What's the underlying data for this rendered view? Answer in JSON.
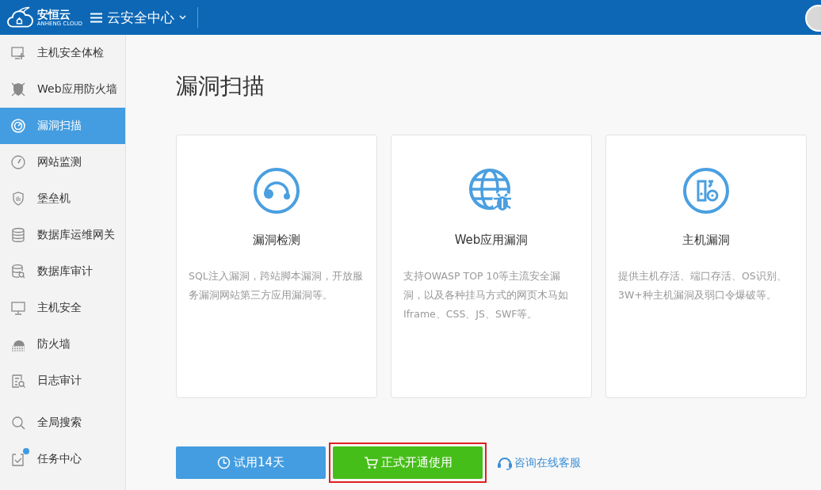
{
  "header": {
    "logo": {
      "name": "安恒云",
      "tagline": "ANHENG CLOUD"
    },
    "menu_title": "云安全中心"
  },
  "sidebar": {
    "groups": [
      [
        {
          "label": "主机安全体检",
          "selected": false
        },
        {
          "label": "Web应用防火墙",
          "selected": false
        },
        {
          "label": "漏洞扫描",
          "selected": true
        },
        {
          "label": "网站监测",
          "selected": false
        },
        {
          "label": "堡垒机",
          "selected": false
        },
        {
          "label": "数据库运维网关",
          "selected": false
        },
        {
          "label": "数据库审计",
          "selected": false
        },
        {
          "label": "主机安全",
          "selected": false
        },
        {
          "label": "防火墙",
          "selected": false
        },
        {
          "label": "日志审计",
          "selected": false
        }
      ],
      [
        {
          "label": "全局搜索",
          "selected": false
        },
        {
          "label": "任务中心",
          "selected": false,
          "badge": true
        }
      ]
    ]
  },
  "page": {
    "title": "漏洞扫描",
    "cards": [
      {
        "title": "漏洞检测",
        "description": "SQL注入漏洞，跨站脚本漏洞，开放服务漏洞网站第三方应用漏洞等。"
      },
      {
        "title": "Web应用漏洞",
        "description": "支持OWASP TOP 10等主流安全漏洞，以及各种挂马方式的网页木马如Iframe、CSS、JS、SWF等。"
      },
      {
        "title": "主机漏洞",
        "description": "提供主机存活、端口存活、OS识别、3W+种主机漏洞及弱口令爆破等。"
      }
    ],
    "actions": [
      {
        "kind": "trial",
        "label": "试用14天"
      },
      {
        "kind": "buy",
        "label": "正式开通使用",
        "highlighted": true
      },
      {
        "kind": "link",
        "label": "咨询在线客服"
      }
    ]
  }
}
